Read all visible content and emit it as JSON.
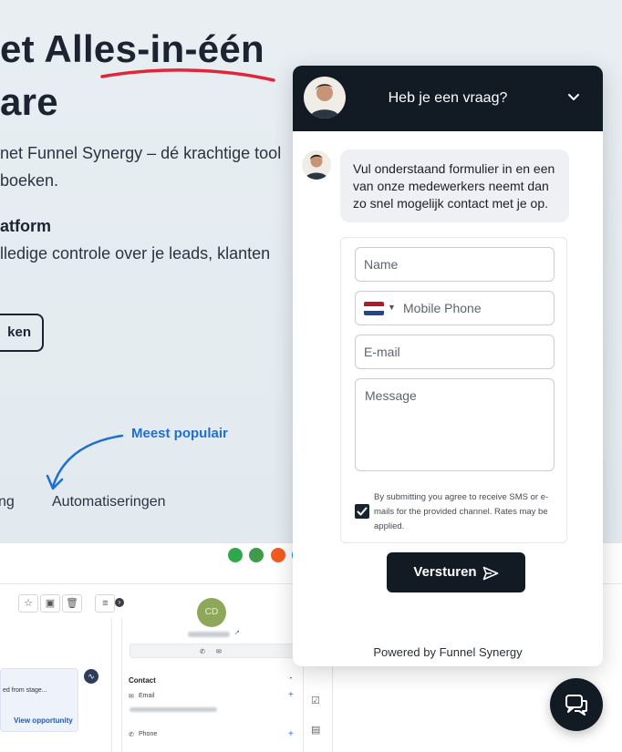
{
  "hero": {
    "heading_line1": "et Alles-in-één",
    "heading_line2": "are",
    "intro_line1": "net Funnel Synergy – dé krachtige tool",
    "intro_line2": "boeken.",
    "feature_heading": "atform",
    "feature_text": "lledige controle over je leads, klanten",
    "cta_label": "ken",
    "popular_label": "Meest populair",
    "tabs": [
      "ng",
      "Automatiseringen"
    ],
    "underline_color": "#e0263a"
  },
  "preview": {
    "avatar_initials": "CD",
    "card_text": "ed from stage...",
    "card_link": "View opportunity",
    "contact_label": "Contact",
    "email_label": "Email",
    "phone_label": "Phone"
  },
  "chat": {
    "title": "Heb je een vraag?",
    "message": "Vul onderstaand formulier in en een van onze medewerkers neemt dan zo snel mogelijk contact met je op.",
    "form": {
      "name_placeholder": "Name",
      "phone_placeholder": "Mobile Phone",
      "email_placeholder": "E-mail",
      "message_placeholder": "Message",
      "consent_checked": true,
      "consent_text": "By submitting you agree to receive SMS or e-mails for the provided channel. Rates may be applied.",
      "submit_label": "Versturen"
    },
    "powered_by": "Powered by Funnel Synergy",
    "header_color": "#121a24"
  }
}
